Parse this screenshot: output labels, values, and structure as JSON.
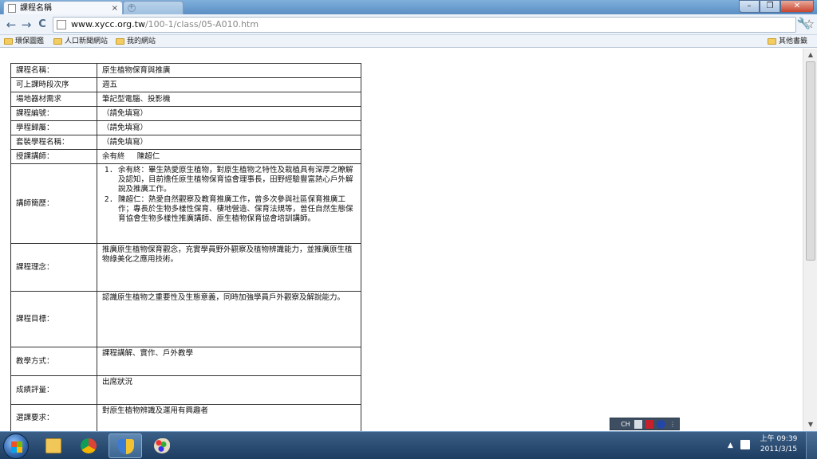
{
  "window": {
    "active_tab_title": "課程名稱",
    "inactive_tab_title": "",
    "close_tab_glyph": "×",
    "new_tab_glyph": "+",
    "minimize_glyph": "–",
    "maximize_glyph": "❐",
    "close_glyph": "✕"
  },
  "toolbar": {
    "back_glyph": "←",
    "forward_glyph": "→",
    "reload_glyph": "C",
    "url_host": "www.xycc.org.tw",
    "url_path": "/100-1/class/05-A010.htm",
    "star_glyph": "☆",
    "wrench_glyph": "🔧"
  },
  "bookmarks": {
    "items": [
      "環保圖鑑",
      "人口新聞網站",
      "我的網站"
    ],
    "other": "其他書籤"
  },
  "course": {
    "rows": [
      {
        "label": "課程名稱：",
        "value": "原生植物保育與推廣"
      },
      {
        "label": "可上課時段次序",
        "value": "週五"
      },
      {
        "label": "場地器材需求",
        "value": "筆記型電腦、投影機"
      },
      {
        "label": "課程編號：",
        "value": "（請免填寫）"
      },
      {
        "label": "學程歸屬：",
        "value": "（請免填寫）"
      },
      {
        "label": "套裝學程名稱：",
        "value": "（請免填寫）"
      },
      {
        "label": "授課講師：",
        "value": "余有終　 陳超仁"
      }
    ],
    "bio_label": "講師簡歷：",
    "bio_items": [
      "余有終：畢生熱愛原生植物，對原生植物之特性及栽植具有深厚之瞭解及認知，目前擔任原生植物保育協會理事長，田野經驗豐富熱心戶外解說及推廣工作。",
      "陳超仁：熱愛自然觀察及教育推廣工作，曾多次參與社區保育推廣工作；專長於生物多樣性保育、棲地營造、保育法規等，曾任自然生態保育協會生物多樣性推廣講師、原生植物保育協會培訓講師。"
    ],
    "idea_label": "課程理念：",
    "idea_value": "推廣原生植物保育觀念，充實學員野外觀察及植物辨識能力，並推廣原生植物綠美化之應用技術。",
    "goal_label": "課程目標：",
    "goal_value": "認識原生植物之重要性及生態意義，同時加強學員戶外觀察及解說能力。",
    "method_label": "教學方式：",
    "method_value": "課程講解、實作、戶外教學",
    "grade_label": "成績評量：",
    "grade_value": "出席狀況",
    "req_label": "選課要求：",
    "req_value": "對原生植物辨識及運用有興趣者"
  },
  "ime": {
    "mode": "CH"
  },
  "taskbar": {
    "time": "上午 09:39",
    "date": "2011/3/15",
    "tray_up_glyph": "▲"
  }
}
